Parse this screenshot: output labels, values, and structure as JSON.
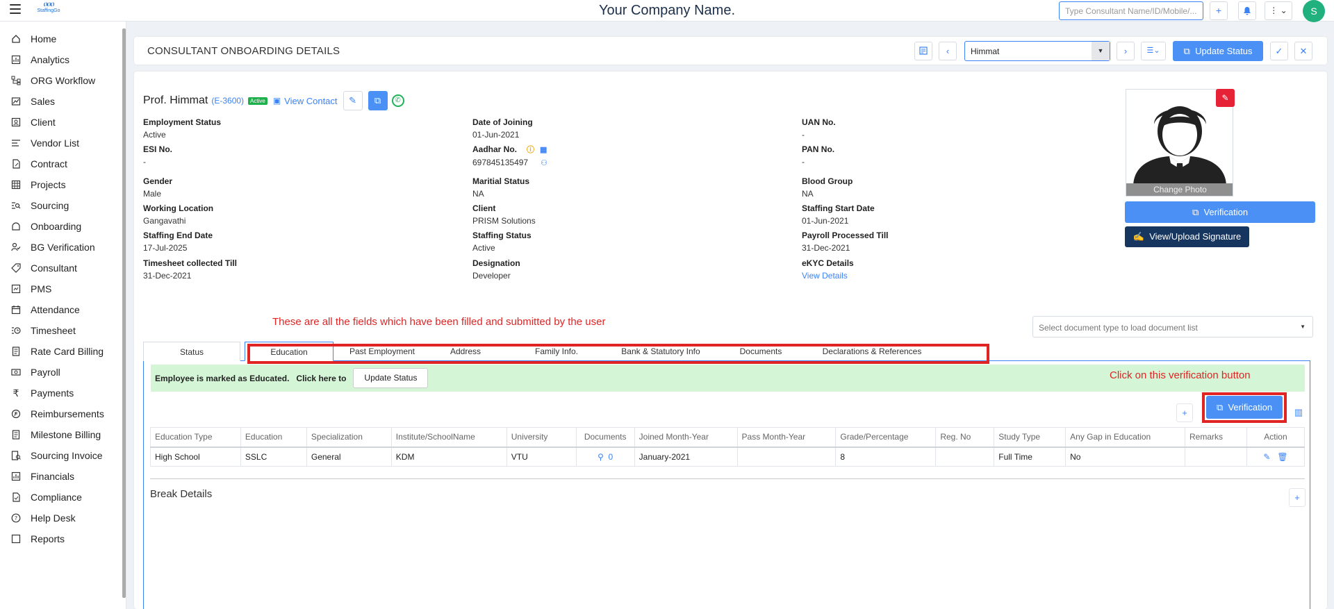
{
  "topbar": {
    "logo_text": "StaffingGo",
    "company": "Your Company Name.",
    "search_placeholder": "Type Consultant Name/ID/Mobile/...",
    "add_label": "+",
    "avatar_initial": "S"
  },
  "sidebar": {
    "items": [
      {
        "label": "Home",
        "icon": "home-icon"
      },
      {
        "label": "Analytics",
        "icon": "chart-icon"
      },
      {
        "label": "ORG Workflow",
        "icon": "workflow-icon"
      },
      {
        "label": "Sales",
        "icon": "sales-icon"
      },
      {
        "label": "Client",
        "icon": "client-icon"
      },
      {
        "label": "Vendor List",
        "icon": "list-icon"
      },
      {
        "label": "Contract",
        "icon": "contract-icon"
      },
      {
        "label": "Projects",
        "icon": "grid-icon"
      },
      {
        "label": "Sourcing",
        "icon": "search-list-icon"
      },
      {
        "label": "Onboarding",
        "icon": "onboarding-icon"
      },
      {
        "label": "BG Verification",
        "icon": "verify-user-icon"
      },
      {
        "label": "Consultant",
        "icon": "tag-icon"
      },
      {
        "label": "PMS",
        "icon": "pms-icon"
      },
      {
        "label": "Attendance",
        "icon": "calendar-icon"
      },
      {
        "label": "Timesheet",
        "icon": "history-icon"
      },
      {
        "label": "Rate Card Billing",
        "icon": "document-icon"
      },
      {
        "label": "Payroll",
        "icon": "payroll-icon"
      },
      {
        "label": "Payments",
        "icon": "rupee-icon"
      },
      {
        "label": "Reimbursements",
        "icon": "reimburse-icon"
      },
      {
        "label": "Milestone Billing",
        "icon": "document-icon"
      },
      {
        "label": "Sourcing Invoice",
        "icon": "invoice-icon"
      },
      {
        "label": "Financials",
        "icon": "chart-icon"
      },
      {
        "label": "Compliance",
        "icon": "compliance-icon"
      },
      {
        "label": "Help Desk",
        "icon": "help-icon"
      },
      {
        "label": "Reports",
        "icon": "report-icon"
      }
    ]
  },
  "header": {
    "title": "CONSULTANT ONBOARDING DETAILS",
    "selected_consultant": "Himmat",
    "update_status_label": "Update Status"
  },
  "profile": {
    "name": "Prof. Himmat",
    "employee_id": "(E-3600)",
    "status_badge": "Active",
    "view_contact": "View Contact",
    "change_photo": "Change Photo",
    "verification_label": "Verification",
    "signature_label": "View/Upload Signature"
  },
  "fields": {
    "employment_status": {
      "label": "Employment Status",
      "value": "Active"
    },
    "date_of_joining": {
      "label": "Date of Joining",
      "value": "01-Jun-2021"
    },
    "uan": {
      "label": "UAN No.",
      "value": "-"
    },
    "esi": {
      "label": "ESI No.",
      "value": "-"
    },
    "aadhar": {
      "label": "Aadhar No.",
      "value": "697845135497"
    },
    "pan": {
      "label": "PAN No.",
      "value": "-"
    },
    "gender": {
      "label": "Gender",
      "value": "Male"
    },
    "marital": {
      "label": "Maritial Status",
      "value": "NA"
    },
    "blood": {
      "label": "Blood Group",
      "value": "NA"
    },
    "location": {
      "label": "Working Location",
      "value": "Gangavathi"
    },
    "client": {
      "label": "Client",
      "value": "PRISM Solutions"
    },
    "staff_start": {
      "label": "Staffing Start Date",
      "value": "01-Jun-2021"
    },
    "staff_end": {
      "label": "Staffing End Date",
      "value": "17-Jul-2025"
    },
    "staff_status": {
      "label": "Staffing Status",
      "value": "Active"
    },
    "payroll_till": {
      "label": "Payroll Processed Till",
      "value": "31-Dec-2021"
    },
    "timesheet_till": {
      "label": "Timesheet collected Till",
      "value": "31-Dec-2021"
    },
    "designation": {
      "label": "Designation",
      "value": "Developer"
    },
    "ekyc": {
      "label": "eKYC Details",
      "value": "View Details"
    }
  },
  "annotations": {
    "fields_note": "These are all the fields which have been filled and submitted by the user",
    "verify_note": "Click on this verification button"
  },
  "doc_select_placeholder": "Select document type to load document list",
  "tabs": [
    {
      "label": "Status"
    },
    {
      "label": "Education"
    },
    {
      "label": "Past Employment"
    },
    {
      "label": "Address"
    },
    {
      "label": "Family Info."
    },
    {
      "label": "Bank & Statutory Info"
    },
    {
      "label": "Documents"
    },
    {
      "label": "Declarations & References"
    }
  ],
  "education": {
    "banner_text": "Employee is marked as Educated.",
    "banner_click": "Click here to",
    "banner_button": "Update Status",
    "verification_label": "Verification",
    "columns": [
      "Education Type",
      "Education",
      "Specialization",
      "Institute/SchoolName",
      "University",
      "Documents",
      "Joined Month-Year",
      "Pass Month-Year",
      "Grade/Percentage",
      "Reg. No",
      "Study Type",
      "Any Gap in Education",
      "Remarks",
      "Action"
    ],
    "rows": [
      {
        "type": "High School",
        "education": "SSLC",
        "specialization": "General",
        "institute": "KDM",
        "university": "VTU",
        "documents": "0",
        "joined": "January-2021",
        "passed": "",
        "grade": "8",
        "reg": "",
        "study": "Full Time",
        "gap": "No",
        "remarks": ""
      }
    ]
  },
  "break_details": {
    "title": "Break Details"
  },
  "colors": {
    "accent": "#4a90f5",
    "annotation": "#e02424",
    "success_bg": "#d4f6d6",
    "dark": "#163660"
  }
}
